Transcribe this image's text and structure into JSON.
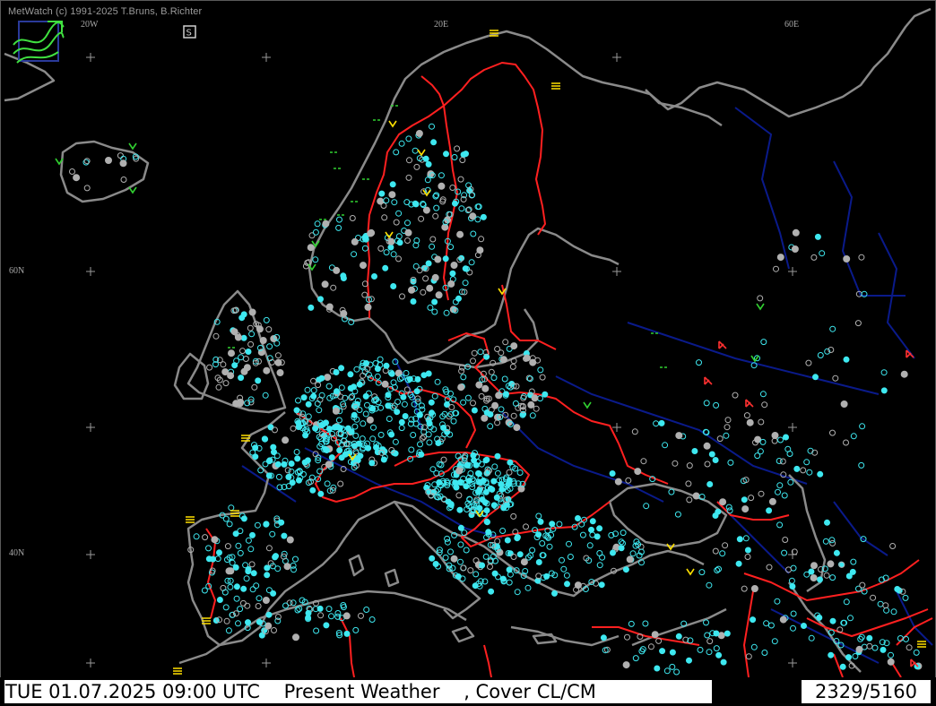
{
  "copyright": "MetWatch  (c) 1991-2025 T.Bruns, B.Richter",
  "grid_labels": {
    "lon_20w": "20W",
    "lon_20e": "20E",
    "lon_60e": "60E",
    "lat_60n": "60N",
    "lat_40n": "40N"
  },
  "status": {
    "datetime": "TUE 01.07.2025 09:00 UTC",
    "parameter": "Present Weather",
    "cover": ", Cover CL/CM",
    "count": "2329/5160"
  },
  "colors": {
    "background": "#000000",
    "coast": "#8a8a8a",
    "border": "#ff2020",
    "river": "#0a1a8a",
    "station_clear": "#3ee8f0",
    "station_other": "#b0b0b0",
    "rain": "#30d030",
    "fog": "#ffe000",
    "storm": "#ff3030"
  },
  "icons": {
    "logo": "metwatch-logo-icon",
    "station_marker": "station-circle-icon",
    "grid_cross": "plus-icon"
  }
}
